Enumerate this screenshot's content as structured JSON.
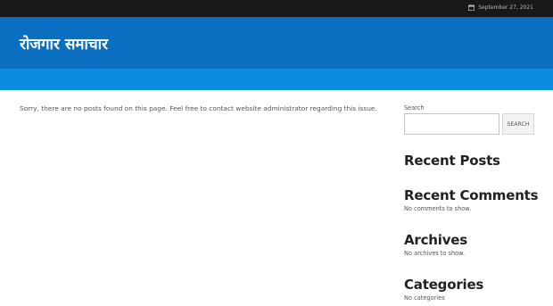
{
  "topbar": {
    "date": "September 27, 2021",
    "icon": "calendar-icon"
  },
  "header": {
    "site_title": "रोजगार समाचार"
  },
  "main": {
    "notice": "Sorry, there are no posts found on this page. Feel free to contact website administrator regarding this issue."
  },
  "sidebar": {
    "search_label": "Search",
    "search_value": "",
    "search_button": "SEARCH",
    "recent_posts": {
      "title": "Recent Posts"
    },
    "recent_comments": {
      "title": "Recent Comments",
      "text": "No comments to show."
    },
    "archives": {
      "title": "Archives",
      "text": "No archives to show."
    },
    "categories": {
      "title": "Categories",
      "text": "No categories"
    }
  },
  "colors": {
    "topbar": "#181818",
    "header": "#0a6fc0",
    "navbar": "#0a8ce0"
  }
}
